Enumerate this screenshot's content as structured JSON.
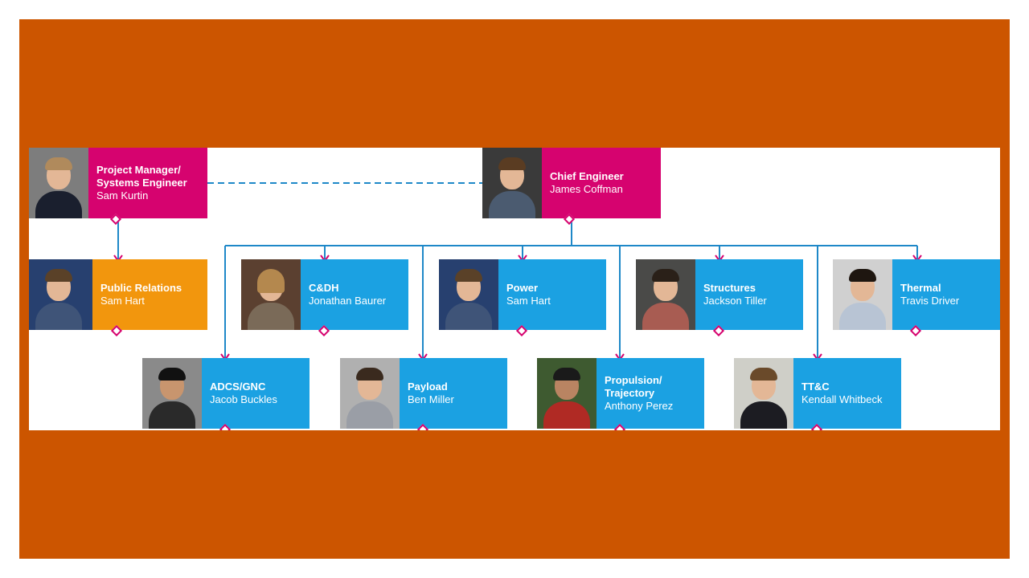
{
  "colors": {
    "frame": "#cc5500",
    "manager": "#d6036f",
    "public_relations": "#f2960d",
    "subsystem": "#1ba1e2",
    "connector": "#1e88c8",
    "diamond": "#d6036f"
  },
  "cards": {
    "project_manager": {
      "title": "Project Manager/\nSystems Engineer",
      "name": "Sam Kurtin"
    },
    "chief_engineer": {
      "title": "Chief Engineer",
      "name": "James Coffman"
    },
    "public_relations": {
      "title": "Public Relations",
      "name": "Sam Hart"
    },
    "cdh": {
      "title": "C&DH",
      "name": "Jonathan Baurer"
    },
    "power": {
      "title": "Power",
      "name": "Sam Hart"
    },
    "structures": {
      "title": "Structures",
      "name": "Jackson Tiller"
    },
    "thermal": {
      "title": "Thermal",
      "name": "Travis Driver"
    },
    "adcs_gnc": {
      "title": "ADCS/GNC",
      "name": "Jacob Buckles"
    },
    "payload": {
      "title": "Payload",
      "name": "Ben Miller"
    },
    "propulsion": {
      "title": "Propulsion/\nTrajectory",
      "name": "Anthony Perez"
    },
    "ttc": {
      "title": "TT&C",
      "name": "Kendall Whitbeck"
    }
  }
}
